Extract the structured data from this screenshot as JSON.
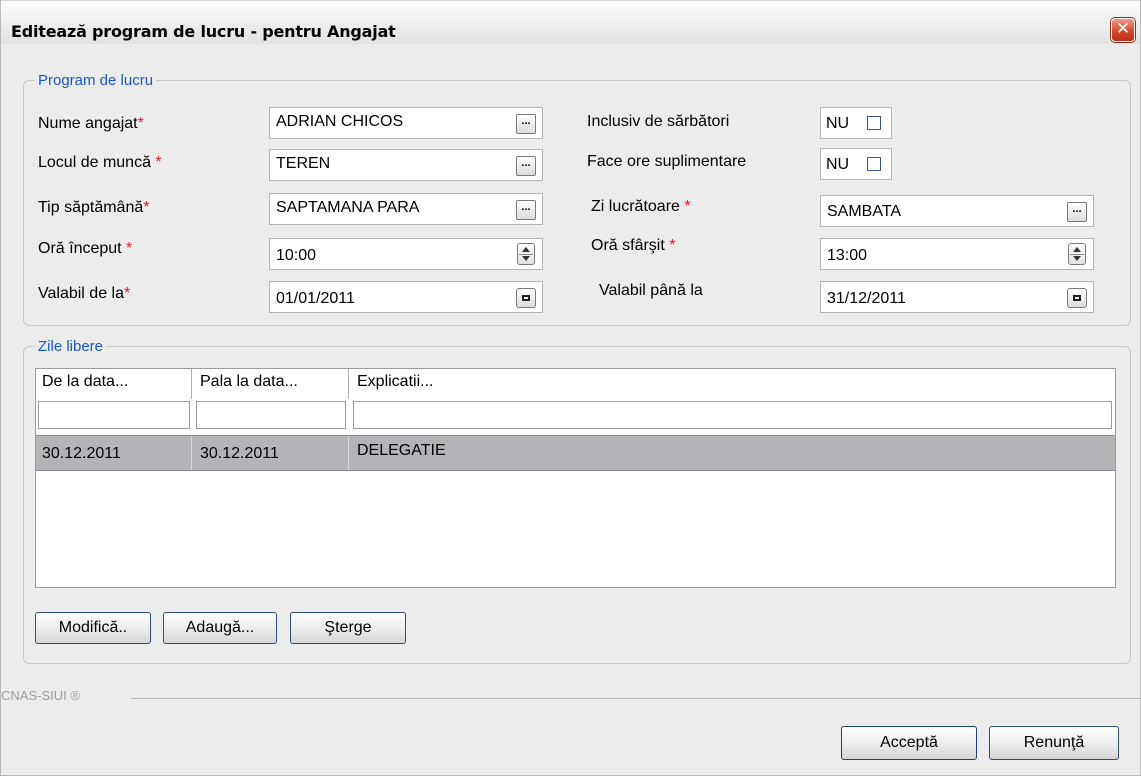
{
  "window": {
    "title": "Editează program de lucru - pentru Angajat",
    "close_glyph": "✕"
  },
  "program": {
    "legend": "Program de lucru",
    "nume_angajat": {
      "label": "Nume angajat",
      "value": "ADRIAN CHICOS"
    },
    "locul_de_munca": {
      "label": "Locul de muncă ",
      "value": "TEREN"
    },
    "tip_saptamana": {
      "label": "Tip săptămână",
      "value": "SAPTAMANA PARA"
    },
    "ora_inceput": {
      "label": "Oră început ",
      "value": "10:00"
    },
    "valabil_de_la": {
      "label": "Valabil de la",
      "value": "01/01/2011"
    },
    "inclusiv_sarbatori": {
      "label": "Inclusiv de sărbători",
      "value": "NU",
      "checked": false
    },
    "ore_suplimentare": {
      "label": "Face ore suplimentare",
      "value": "NU",
      "checked": false
    },
    "zi_lucratoare": {
      "label": "Zi lucrătoare ",
      "value": "SAMBATA"
    },
    "ora_sfarsit": {
      "label": "Oră sfârşit ",
      "value": "13:00"
    },
    "valabil_pana_la": {
      "label": "Valabil până la",
      "value": "31/12/2011"
    },
    "required_mark": "*",
    "picker_glyph": "..."
  },
  "zile_libere": {
    "legend": "Zile libere",
    "columns": [
      "De la data...",
      "Pala la data...",
      "Explicatii..."
    ],
    "rows": [
      {
        "de_la": "30.12.2011",
        "pana_la": "30.12.2011",
        "explicatii": "DELEGATIE"
      }
    ],
    "buttons": {
      "modifica": "Modifică..",
      "adauga": "Adaugă...",
      "sterge": "Şterge"
    }
  },
  "footer": {
    "brand": "CNAS-SIUI ®",
    "accept": "Acceptă",
    "renunta": "Renunţă"
  },
  "colors": {
    "accent": "#1a55c8",
    "required": "#e0201b",
    "selected_row": "#b4b4b8"
  }
}
